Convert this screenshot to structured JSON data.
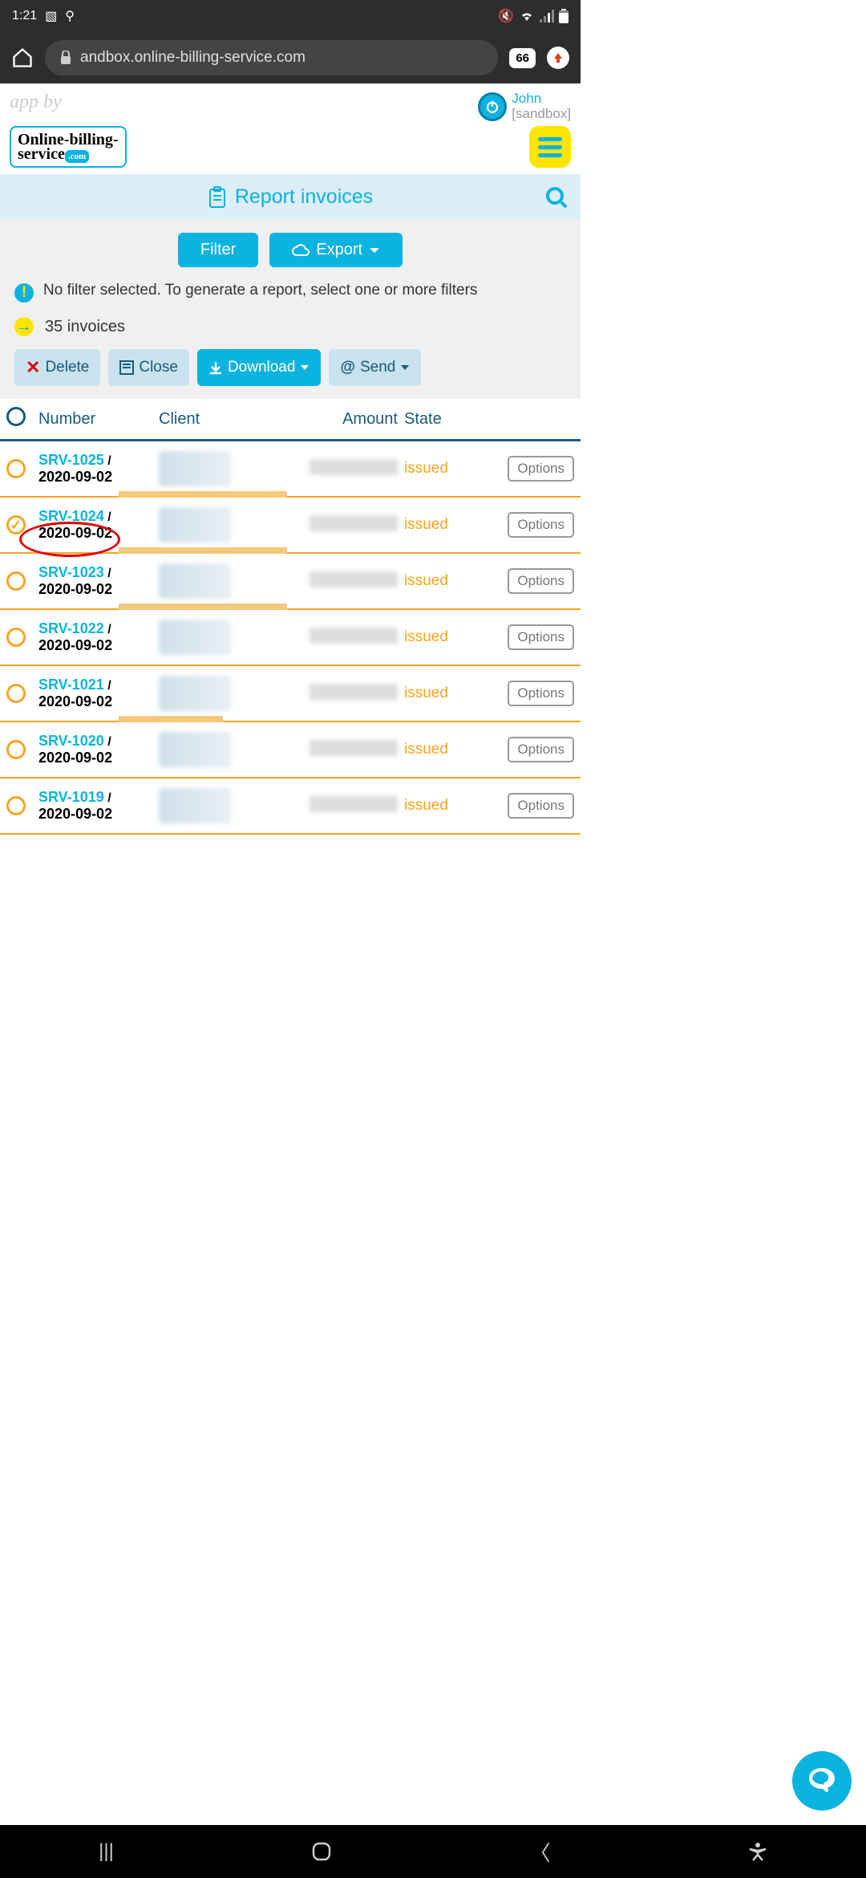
{
  "status": {
    "time": "1:21"
  },
  "browser": {
    "url": "andbox.online-billing-service.com",
    "tabs": "66"
  },
  "header": {
    "app_by": "app by",
    "user_name": "John",
    "user_env": "[sandbox]",
    "logo_l1": "Online-billing-",
    "logo_l2": "service",
    "logo_com": ".com"
  },
  "page": {
    "title": "Report invoices",
    "filter_btn": "Filter",
    "export_btn": "Export",
    "info": "No filter selected. To generate a report, select one or more filters",
    "count": "35 invoices",
    "delete_btn": "Delete",
    "close_btn": "Close",
    "download_btn": "Download",
    "send_btn": "Send"
  },
  "table": {
    "headers": {
      "number": "Number",
      "client": "Client",
      "amount": "Amount",
      "state": "State"
    },
    "options_label": "Options",
    "rows": [
      {
        "num": "SRV-1025",
        "date": "2020-09-02",
        "state": "issued",
        "checked": false,
        "prog": 210
      },
      {
        "num": "SRV-1024",
        "date": "2020-09-02",
        "state": "issued",
        "checked": true,
        "prog": 210
      },
      {
        "num": "SRV-1023",
        "date": "2020-09-02",
        "state": "issued",
        "checked": false,
        "prog": 210
      },
      {
        "num": "SRV-1022",
        "date": "2020-09-02",
        "state": "issued",
        "checked": false,
        "prog": 0
      },
      {
        "num": "SRV-1021",
        "date": "2020-09-02",
        "state": "issued",
        "checked": false,
        "prog": 130
      },
      {
        "num": "SRV-1020",
        "date": "2020-09-02",
        "state": "issued",
        "checked": false,
        "prog": 0
      },
      {
        "num": "SRV-1019",
        "date": "2020-09-02",
        "state": "issued",
        "checked": false,
        "prog": 0
      }
    ]
  }
}
